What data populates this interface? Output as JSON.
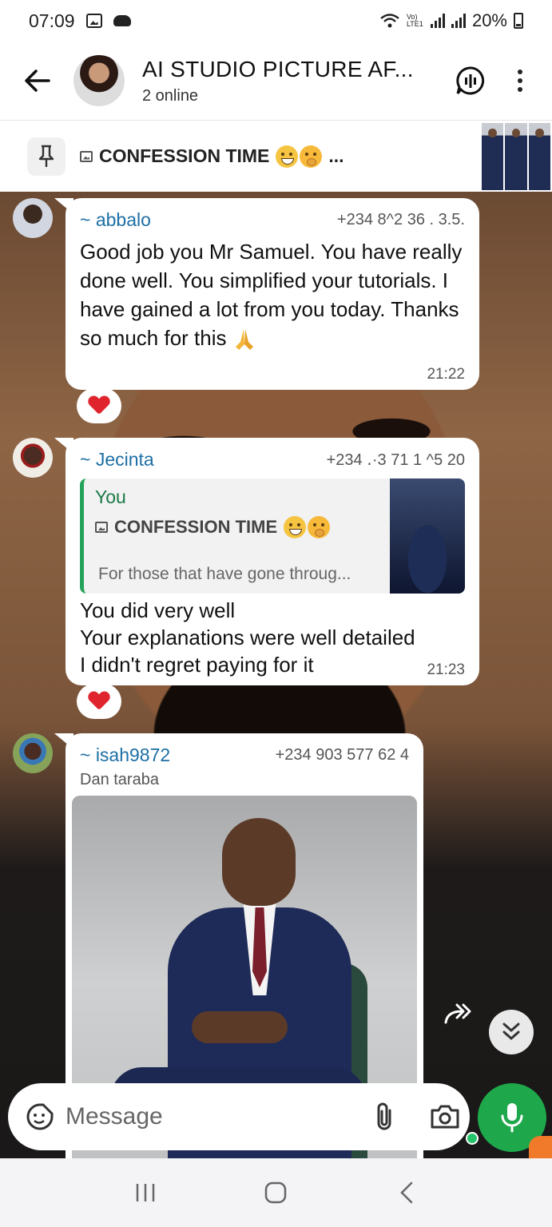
{
  "status_bar": {
    "time": "07:09",
    "network_label": "Vo) LTE1",
    "battery": "20%"
  },
  "header": {
    "title": "AI STUDIO PICTURE AF...",
    "subtitle": "2 online"
  },
  "pinned": {
    "text": "CONFESSION TIME",
    "suffix": "..."
  },
  "messages": [
    {
      "sender": "~ abbalo",
      "phone": "+234 8^2 36 . 3.5.",
      "text": "Good job you Mr Samuel. You have really done well. You simplified your tutorials. I have gained a lot from you today. Thanks so much for this",
      "time": "21:22",
      "reaction": "heart"
    },
    {
      "sender": "~ Jecinta",
      "phone": "+234 ․·3 71 1 ^5 20",
      "quote": {
        "author": "You",
        "title": "CONFESSION TIME",
        "preview": "For those that have gone throug..."
      },
      "text": "You did very well\nYour explanations were well detailed\nI didn't regret paying for it",
      "time": "21:23",
      "reaction": "heart"
    },
    {
      "sender": "~ isah9872",
      "phone": "+234 903 577 62 4",
      "subtitle": "Dan taraba",
      "has_photo": true
    }
  ],
  "composer": {
    "placeholder": "Message"
  },
  "colors": {
    "accent_green": "#1ea84b",
    "sender_blue": "#1d6fa5",
    "heart_red": "#e0242e"
  },
  "icons": [
    "back-arrow-icon",
    "call-icon",
    "more-icon",
    "pin-icon",
    "heart-icon",
    "forward-icon",
    "chevrons-down-icon",
    "sticker-icon",
    "paperclip-icon",
    "camera-icon",
    "mic-icon"
  ]
}
